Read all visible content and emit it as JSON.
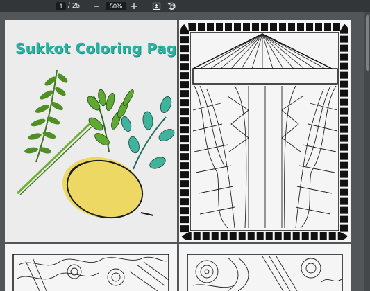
{
  "toolbar": {
    "current_page": "1",
    "page_separator": "/",
    "total_pages": "25",
    "zoom": "50%",
    "zoom_out_icon": "minus-icon",
    "zoom_in_icon": "plus-icon",
    "fit_icon": "fit-page-icon",
    "rotate_icon": "rotate-icon"
  },
  "pages": {
    "cover_title": "Sukkot Coloring Pages"
  },
  "colors": {
    "toolbar_bg": "#323639",
    "viewer_bg": "#525659",
    "title_teal": "#2ab1a1",
    "etrog_yellow": "#ecd862",
    "leaf_green": "#5fa832",
    "leaf_teal": "#3fb39b"
  }
}
